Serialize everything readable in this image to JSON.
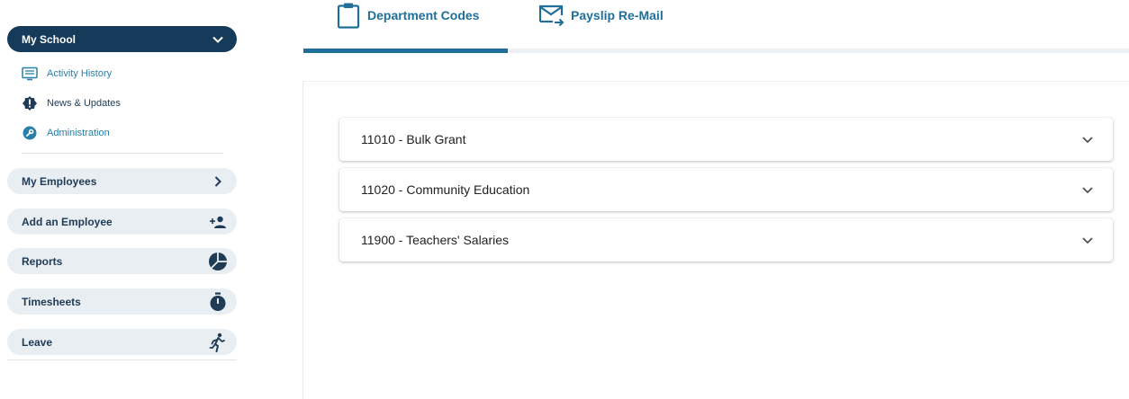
{
  "sidebar": {
    "section": {
      "label": "My School",
      "icon": "chevron-down-icon"
    },
    "subitems": [
      {
        "label": "Activity History",
        "icon": "activity-list-icon"
      },
      {
        "label": "News & Updates",
        "icon": "alert-badge-icon"
      },
      {
        "label": "Administration",
        "icon": "wrench-icon"
      }
    ],
    "nav": [
      {
        "label": "My Employees",
        "icon": "chevron-right-icon"
      },
      {
        "label": "Add an Employee",
        "icon": "add-person-icon"
      },
      {
        "label": "Reports",
        "icon": "pie-chart-icon"
      },
      {
        "label": "Timesheets",
        "icon": "stopwatch-icon"
      },
      {
        "label": "Leave",
        "icon": "running-person-icon"
      }
    ]
  },
  "tabs": [
    {
      "label": "Department Codes",
      "icon": "clipboard-icon",
      "active": true
    },
    {
      "label": "Payslip Re-Mail",
      "icon": "mail-forward-icon",
      "active": false
    }
  ],
  "accordion": [
    {
      "label": "11010 - Bulk Grant"
    },
    {
      "label": "11020 - Community Education"
    },
    {
      "label": "11900 - Teachers' Salaries"
    }
  ],
  "colors": {
    "navy": "#163a5a",
    "accent": "#1f6f9a",
    "link": "#2a7fa8",
    "pill": "#e9eef3"
  }
}
